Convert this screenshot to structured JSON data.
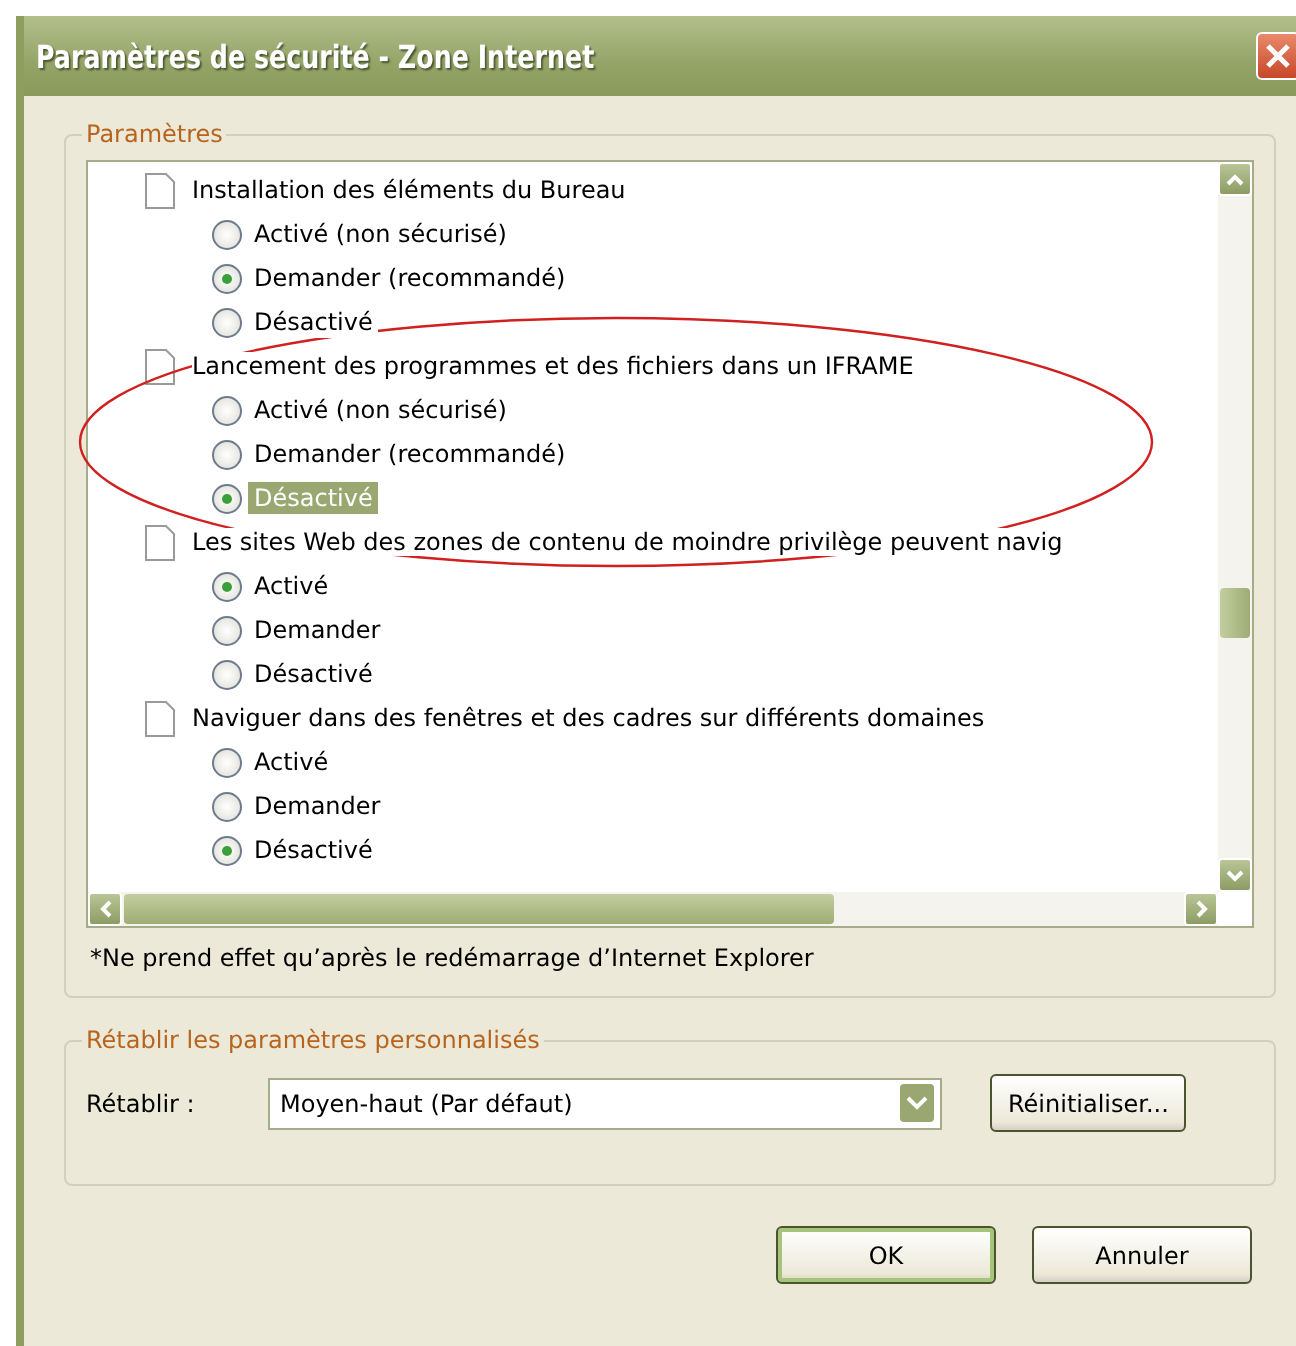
{
  "window": {
    "title": "Paramètres de sécurité - Zone Internet"
  },
  "settings_group": {
    "legend": "Paramètres",
    "settings": [
      {
        "label": "Installation des éléments du Bureau",
        "options": [
          {
            "label": "Activé (non sécurisé)",
            "selected": false,
            "focused": false
          },
          {
            "label": "Demander (recommandé)",
            "selected": true,
            "focused": false
          },
          {
            "label": "Désactivé",
            "selected": false,
            "focused": false
          }
        ]
      },
      {
        "label": "Lancement des programmes et des fichiers dans un IFRAME",
        "options": [
          {
            "label": "Activé (non sécurisé)",
            "selected": false,
            "focused": false
          },
          {
            "label": "Demander (recommandé)",
            "selected": false,
            "focused": false
          },
          {
            "label": "Désactivé",
            "selected": true,
            "focused": true
          }
        ]
      },
      {
        "label": "Les sites Web des zones de contenu de moindre privilège peuvent navig",
        "options": [
          {
            "label": "Activé",
            "selected": true,
            "focused": false
          },
          {
            "label": "Demander",
            "selected": false,
            "focused": false
          },
          {
            "label": "Désactivé",
            "selected": false,
            "focused": false
          }
        ]
      },
      {
        "label": "Naviguer dans des fenêtres et des cadres sur différents domaines",
        "options": [
          {
            "label": "Activé",
            "selected": false,
            "focused": false
          },
          {
            "label": "Demander",
            "selected": false,
            "focused": false
          },
          {
            "label": "Désactivé",
            "selected": true,
            "focused": false
          }
        ]
      }
    ],
    "note": "*Ne prend effet qu’après le redémarrage d’Internet Explorer"
  },
  "reset_group": {
    "legend": "Rétablir les paramètres personnalisés",
    "label": "Rétablir :",
    "level_value": "Moyen-haut (Par défaut)",
    "reset_button": "Réinitialiser..."
  },
  "buttons": [
    {
      "label": "OK",
      "default": true
    },
    {
      "label": "Annuler",
      "default": false
    }
  ]
}
